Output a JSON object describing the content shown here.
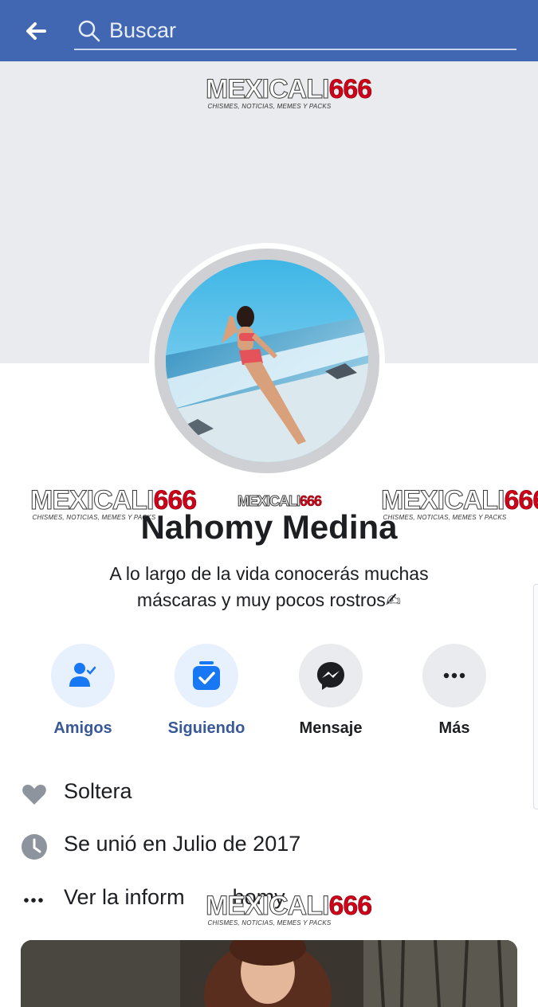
{
  "header": {
    "search_placeholder": "Buscar"
  },
  "watermark": {
    "main_white": "MEXICALI",
    "main_red": "666",
    "tagline": "CHISMES, NOTICIAS, MEMES Y PACKS"
  },
  "profile": {
    "name": "Nahomy Medina",
    "bio_line1": "A lo largo de la vida conocerás muchas",
    "bio_line2": "máscaras y muy pocos rostros✍"
  },
  "actions": [
    {
      "label": "Amigos",
      "icon": "friends-check-icon"
    },
    {
      "label": "Siguiendo",
      "icon": "following-check-icon"
    },
    {
      "label": "Mensaje",
      "icon": "messenger-icon"
    },
    {
      "label": "Más",
      "icon": "more-dots-icon"
    }
  ],
  "info": [
    {
      "text": "Soltera",
      "icon": "heart-icon"
    },
    {
      "text": "Se unió en Julio de 2017",
      "icon": "clock-icon"
    },
    {
      "text": "Ver la inform        homy",
      "icon": "more-dots-icon"
    }
  ],
  "colors": {
    "brand_blue": "#4267b2",
    "link_blue": "#385898",
    "icon_blue": "#1877f2",
    "watermark_red": "#d0021b"
  }
}
